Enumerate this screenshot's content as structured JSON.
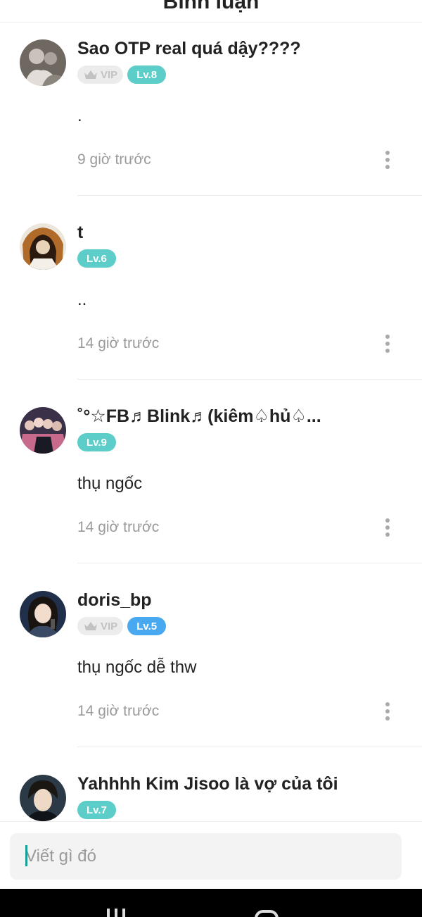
{
  "header": {
    "title": "Bình luận"
  },
  "colors": {
    "teal": "#5ccdc8",
    "blue": "#48a8f0",
    "vip_text": "#c2c2c2",
    "vip_bg": "#ececec"
  },
  "comments": [
    {
      "username": "Sao OTP real quá dậy????",
      "vip": true,
      "vip_label": "VIP",
      "level": "Lv.8",
      "level_color": "#5ccdc8",
      "text": ".",
      "time": "9 giờ trước"
    },
    {
      "username": "t",
      "vip": false,
      "vip_label": "",
      "level": "Lv.6",
      "level_color": "#5ccdc8",
      "text": "..",
      "time": "14 giờ trước"
    },
    {
      "username": "˚°☆FB♬Blink♬(kiêm♤hủ♤...",
      "vip": false,
      "vip_label": "",
      "level": "Lv.9",
      "level_color": "#5ccdc8",
      "text": "thụ ngốc",
      "time": "14 giờ trước"
    },
    {
      "username": "doris_bp",
      "vip": true,
      "vip_label": "VIP",
      "level": "Lv.5",
      "level_color": "#48a8f0",
      "text": "thụ ngốc dễ thw",
      "time": "14 giờ trước"
    },
    {
      "username": "Yahhhh Kim Jisoo là vợ của tôi",
      "vip": false,
      "vip_label": "",
      "level": "Lv.7",
      "level_color": "#5ccdc8",
      "text": "",
      "time": ""
    }
  ],
  "input": {
    "placeholder": "Viết gì đó",
    "value": ""
  }
}
